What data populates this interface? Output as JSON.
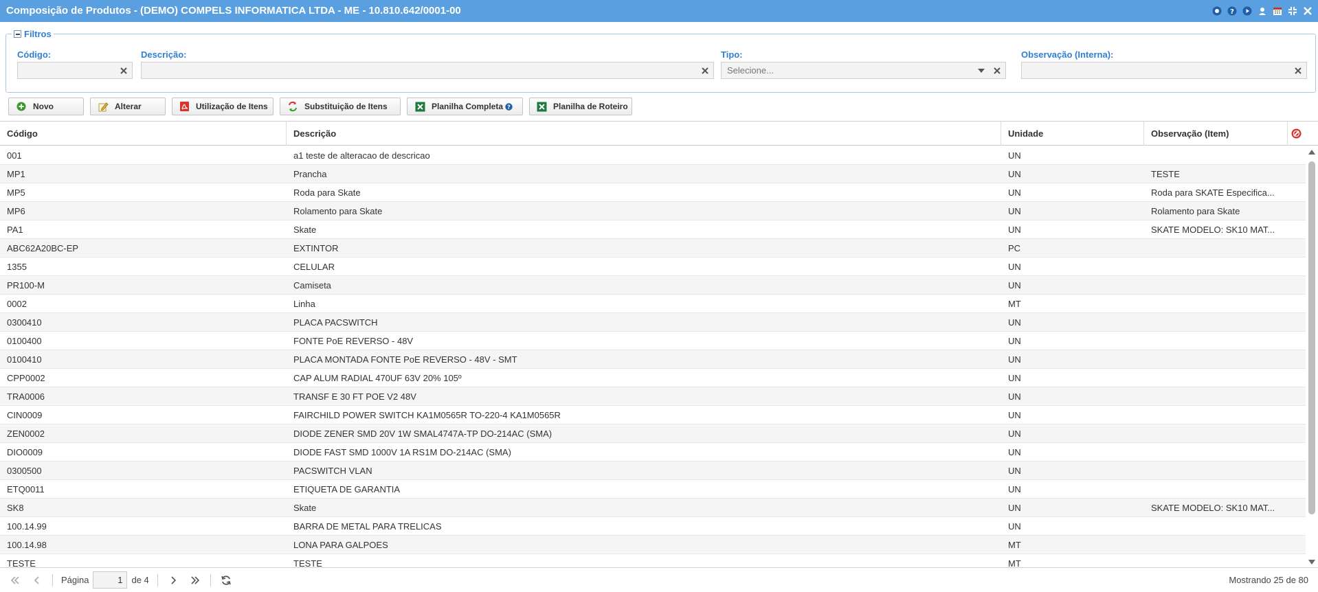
{
  "window": {
    "title": "Composição de Produtos - (DEMO) COMPELS INFORMATICA LTDA - ME - 10.810.642/0001-00",
    "tools": [
      "record-icon",
      "help-icon",
      "play-icon",
      "user-icon",
      "calendar-icon",
      "compress-icon",
      "close-icon"
    ]
  },
  "filters": {
    "legend": "Filtros",
    "codigo": {
      "label": "Código:",
      "value": ""
    },
    "descricao": {
      "label": "Descrição:",
      "value": ""
    },
    "tipo": {
      "label": "Tipo:",
      "value": "Selecione..."
    },
    "observacao": {
      "label": "Observação (Interna):",
      "value": ""
    }
  },
  "toolbar": {
    "novo": "Novo",
    "alterar": "Alterar",
    "utilizacao": "Utilização de Itens",
    "substituicao": "Substituição de Itens",
    "planilha_completa": "Planilha Completa",
    "planilha_roteiro": "Planilha de Roteiro"
  },
  "grid": {
    "columns": [
      "Código",
      "Descrição",
      "Unidade",
      "Observação (Item)"
    ],
    "rows": [
      [
        "001",
        "a1 teste de alteracao de descricao",
        "UN",
        ""
      ],
      [
        "MP1",
        "Prancha",
        "UN",
        "TESTE"
      ],
      [
        "MP5",
        "Roda para Skate",
        "UN",
        "Roda para SKATE Especifica..."
      ],
      [
        "MP6",
        "Rolamento para Skate",
        "UN",
        "Rolamento para Skate"
      ],
      [
        "PA1",
        "Skate",
        "UN",
        "SKATE MODELO: SK10 MAT..."
      ],
      [
        "ABC62A20BC-EP",
        "EXTINTOR",
        "PC",
        ""
      ],
      [
        "1355",
        "CELULAR",
        "UN",
        ""
      ],
      [
        "PR100-M",
        "Camiseta",
        "UN",
        ""
      ],
      [
        "0002",
        "Linha",
        "MT",
        ""
      ],
      [
        "0300410",
        "PLACA PACSWITCH",
        "UN",
        ""
      ],
      [
        "0100400",
        "FONTE PoE REVERSO - 48V",
        "UN",
        ""
      ],
      [
        "0100410",
        "PLACA MONTADA FONTE PoE REVERSO - 48V - SMT",
        "UN",
        ""
      ],
      [
        "CPP0002",
        "CAP ALUM RADIAL 470UF 63V 20% 105º",
        "UN",
        ""
      ],
      [
        "TRA0006",
        "TRANSF E 30 FT POE V2 48V",
        "UN",
        ""
      ],
      [
        "CIN0009",
        "FAIRCHILD POWER SWITCH KA1M0565R TO-220-4 KA1M0565R",
        "UN",
        ""
      ],
      [
        "ZEN0002",
        "DIODE ZENER SMD 20V 1W SMAL4747A-TP DO-214AC (SMA)",
        "UN",
        ""
      ],
      [
        "DIO0009",
        "DIODE FAST SMD 1000V 1A RS1M DO-214AC (SMA)",
        "UN",
        ""
      ],
      [
        "0300500",
        "PACSWITCH VLAN",
        "UN",
        ""
      ],
      [
        "ETQ0011",
        "ETIQUETA DE GARANTIA",
        "UN",
        ""
      ],
      [
        "SK8",
        "Skate",
        "UN",
        "SKATE MODELO: SK10 MAT..."
      ],
      [
        "100.14.99",
        "BARRA DE METAL PARA TRELICAS",
        "UN",
        ""
      ],
      [
        "100.14.98",
        "LONA PARA GALPOES",
        "MT",
        ""
      ],
      [
        "TESTE",
        "TESTE",
        "MT",
        ""
      ]
    ]
  },
  "pager": {
    "page_label": "Página",
    "page": "1",
    "of_label": "de 4",
    "status": "Mostrando 25 de 80"
  },
  "colors": {
    "titlebar": "#5a9fe0",
    "accent": "#2f7fd3"
  }
}
